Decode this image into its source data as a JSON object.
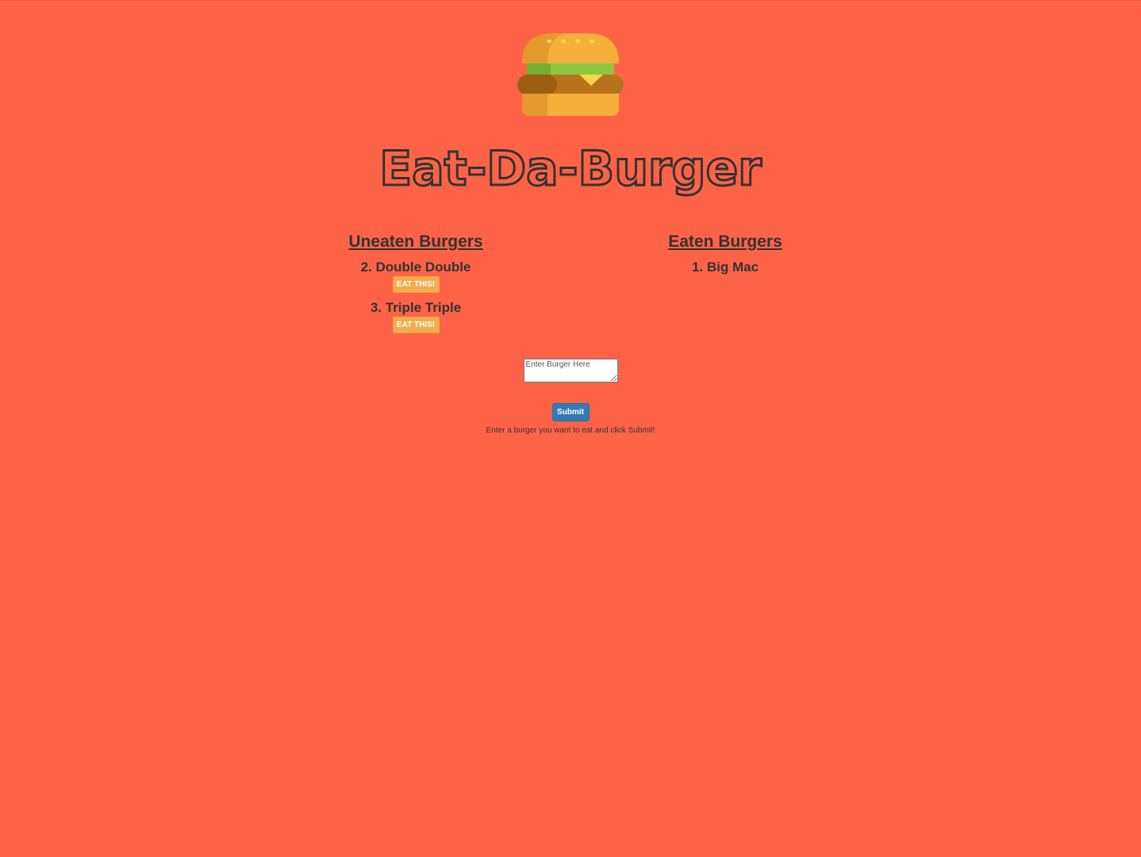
{
  "header": {
    "title": "Eat-Da-Burger",
    "logo_icon": "burger-icon"
  },
  "uneaten": {
    "heading": "Uneaten Burgers",
    "items": [
      {
        "label": "2. Double Double",
        "button": "EAT THIS!"
      },
      {
        "label": "3. Triple Triple",
        "button": "EAT THIS!"
      }
    ]
  },
  "eaten": {
    "heading": "Eaten Burgers",
    "items": [
      {
        "label": "1. Big Mac"
      }
    ]
  },
  "form": {
    "placeholder": "Enter Burger Here",
    "value": "",
    "submit_label": "Submit",
    "help_text": "Enter a burger you want to eat and click Submit!"
  },
  "colors": {
    "background": "#ff6347",
    "eat_button": "#f0ad4e",
    "submit_button": "#337ab7",
    "text": "#333333"
  }
}
